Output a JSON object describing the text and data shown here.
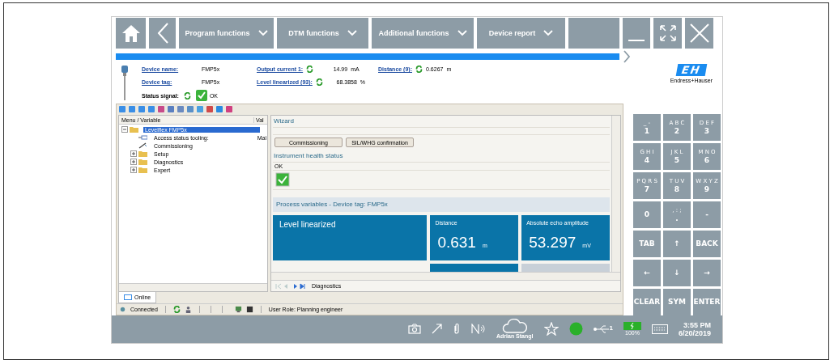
{
  "toolbar": {
    "menus": [
      {
        "label": "Program functions"
      },
      {
        "label": "DTM functions"
      },
      {
        "label": "Additional functions"
      },
      {
        "label": "Device report"
      }
    ]
  },
  "header": {
    "fields": [
      {
        "label": "Device name:",
        "value": "FMP5x",
        "refresh": false
      },
      {
        "label": "Output current 1:",
        "value": "14.99",
        "unit": "mA",
        "refresh": true
      },
      {
        "label": "Distance (9):",
        "value": "0.6267",
        "unit": "m",
        "refresh": true
      },
      {
        "label": "Device tag:",
        "value": "FMP5x",
        "refresh": false
      },
      {
        "label": "Level linearized (93):",
        "value": "68.3858",
        "unit": "%",
        "refresh": true
      }
    ],
    "status_signal": {
      "label": "Status signal:",
      "value": "OK",
      "refresh": true,
      "ok": true
    },
    "logo": {
      "mark": "EH",
      "name": "Endress+Hauser"
    }
  },
  "tree": {
    "columns": [
      "Menu / Variable",
      "Val"
    ],
    "items": [
      {
        "label": "Levelflex FMP5x",
        "kind": "folder",
        "selected": true,
        "expanded": true,
        "children": [
          {
            "label": "Access status tooling:",
            "kind": "parameter",
            "value": "Mai",
            "selected": false
          },
          {
            "label": "Commissioning",
            "kind": "wizard",
            "selected": false
          },
          {
            "label": "Setup",
            "kind": "folder",
            "selected": false,
            "expanded": false
          },
          {
            "label": "Diagnostics",
            "kind": "folder",
            "selected": false,
            "expanded": false
          },
          {
            "label": "Expert",
            "kind": "folder",
            "selected": false,
            "expanded": false
          }
        ]
      }
    ]
  },
  "wizard": {
    "title": "Wizard",
    "buttons": [
      "Commissioning",
      "SIL/WHG confirmation"
    ]
  },
  "health": {
    "title": "Instrument health status",
    "status": "OK",
    "ok": true
  },
  "process": {
    "title": "Process variables - Device tag: FMP5x",
    "tiles": [
      {
        "label": "Level linearized",
        "kind": "large"
      },
      {
        "label": "Distance",
        "value": "0.631",
        "unit": "m",
        "kind": "small"
      },
      {
        "label": "Absolute echo amplitude",
        "value": "53.297",
        "unit": "mV",
        "kind": "small"
      }
    ]
  },
  "nav": {
    "label": "Diagnostics"
  },
  "tabs": [
    {
      "label": "Online",
      "selected": true
    }
  ],
  "status_bar": {
    "connection": "Connected",
    "role": "User Role: Planning engineer"
  },
  "keypad": {
    "keys": [
      {
        "label": "1",
        "sub": "_ -"
      },
      {
        "label": "2",
        "sub": "A B C"
      },
      {
        "label": "3",
        "sub": "D E F"
      },
      {
        "label": "4",
        "sub": "G H I"
      },
      {
        "label": "5",
        "sub": "J K L"
      },
      {
        "label": "6",
        "sub": "M N O"
      },
      {
        "label": "7",
        "sub": "P Q R S"
      },
      {
        "label": "8",
        "sub": "T U V"
      },
      {
        "label": "9",
        "sub": "W X Y Z"
      },
      {
        "label": "0"
      },
      {
        "label": ".",
        "sub": ", : ;"
      },
      {
        "label": "-"
      },
      {
        "label": "TAB"
      },
      {
        "label": "↑"
      },
      {
        "label": "BACK"
      },
      {
        "label": "←"
      },
      {
        "label": "↓"
      },
      {
        "label": "→"
      },
      {
        "label": "CLEAR"
      },
      {
        "label": "SYM"
      },
      {
        "label": "ENTER"
      }
    ]
  },
  "taskbar": {
    "user": "Adrian Stangl",
    "usb_count": "1",
    "battery": "100%",
    "time": "3:55 PM",
    "date": "6/20/2019"
  }
}
